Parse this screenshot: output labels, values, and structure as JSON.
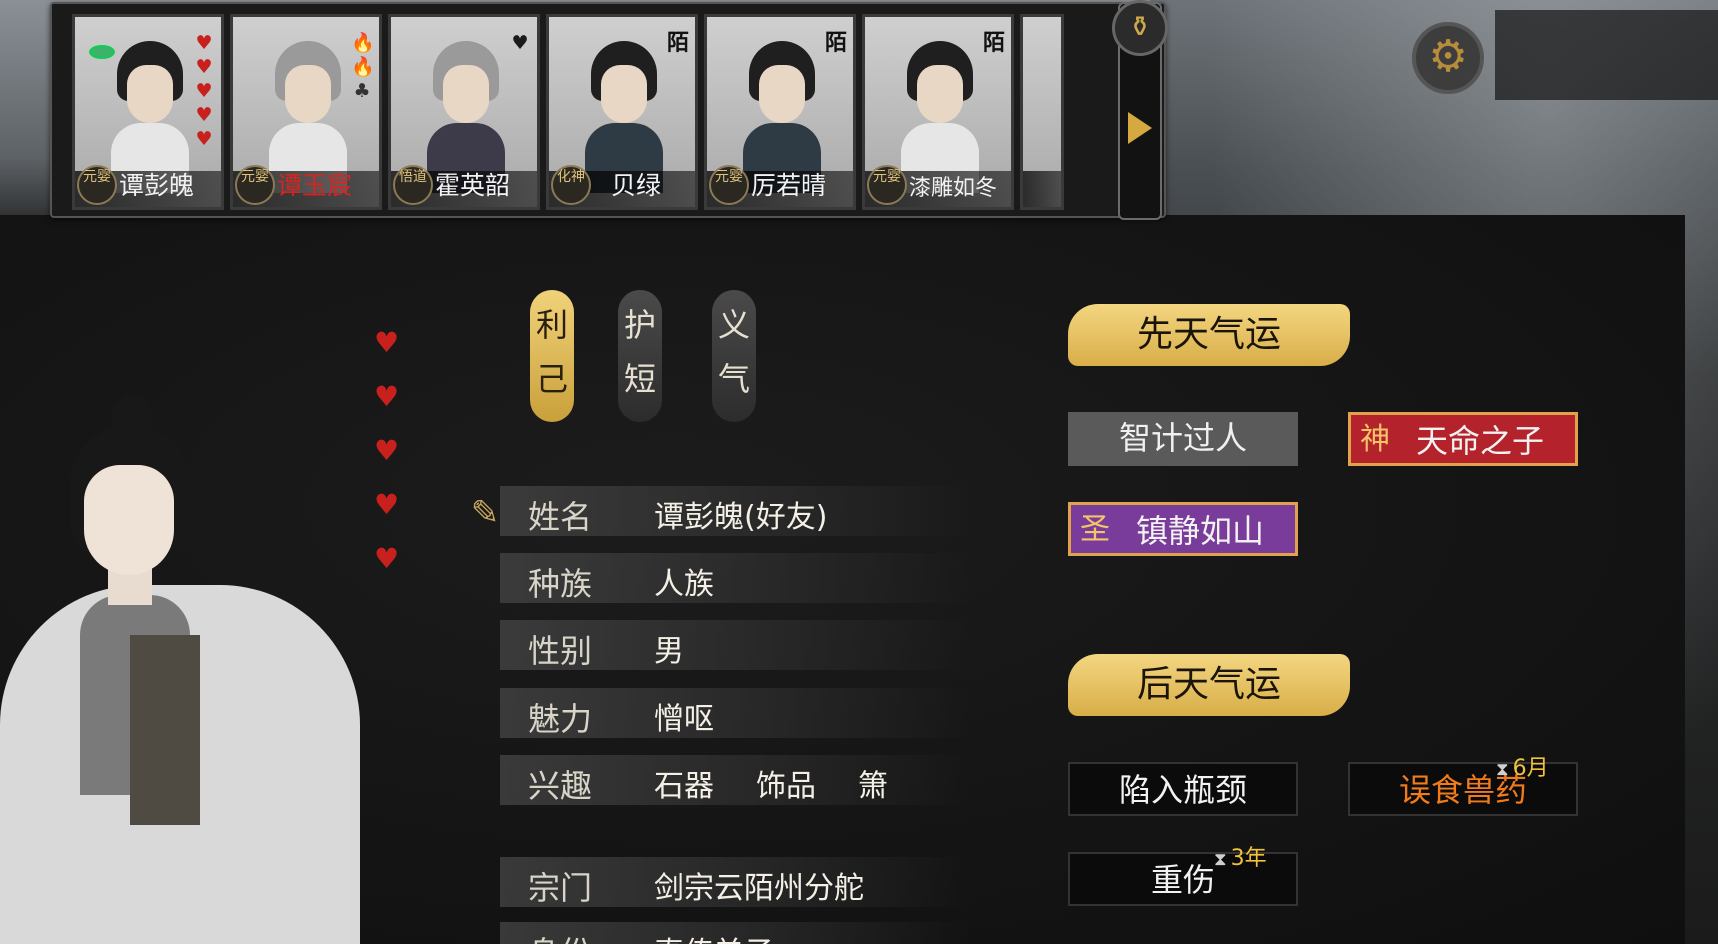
{
  "characters": [
    {
      "name": "谭彭魄",
      "realm": "元婴",
      "style": "red-hearts",
      "hearts": 5,
      "tag": "",
      "name_color": "white"
    },
    {
      "name": "谭玉宸",
      "realm": "元婴",
      "style": "flames",
      "hearts": 3,
      "tag": "",
      "name_color": "red"
    },
    {
      "name": "霍英韶",
      "realm": "悟道",
      "style": "one-heart",
      "hearts": 1,
      "tag": "",
      "name_color": "white"
    },
    {
      "name": "贝绿",
      "realm": "化神",
      "style": "tag",
      "hearts": 0,
      "tag": "陌",
      "name_color": "white"
    },
    {
      "name": "厉若晴",
      "realm": "元婴",
      "style": "tag",
      "hearts": 0,
      "tag": "陌",
      "name_color": "white"
    },
    {
      "name": "漆雕如冬",
      "realm": "元婴",
      "style": "tag",
      "hearts": 0,
      "tag": "陌",
      "name_color": "white"
    }
  ],
  "traits": [
    {
      "text1": "利",
      "text2": "己",
      "active": true
    },
    {
      "text1": "护",
      "text2": "短",
      "active": false
    },
    {
      "text1": "义",
      "text2": "气",
      "active": false
    }
  ],
  "info": {
    "name_label": "姓名",
    "name_value": "谭彭魄(好友)",
    "race_label": "种族",
    "race_value": "人族",
    "gender_label": "性别",
    "gender_value": "男",
    "charm_label": "魅力",
    "charm_value": "憎呕",
    "hobby_label": "兴趣",
    "hobbies": [
      "石器",
      "饰品",
      "箫"
    ],
    "sect_label": "宗门",
    "sect_value": "剑宗云陌州分舵",
    "identity_label": "身份",
    "identity_value": "真传弟子"
  },
  "fortune": {
    "innate_header": "先天气运",
    "innate": [
      {
        "text": "智计过人",
        "style": "grey",
        "seal": ""
      },
      {
        "text": "天命之子",
        "style": "red",
        "seal": "神"
      },
      {
        "text": "镇静如山",
        "style": "purple",
        "seal": "圣"
      }
    ],
    "acquired_header": "后天气运",
    "acquired": [
      {
        "text": "陷入瓶颈",
        "style": "black",
        "timer": ""
      },
      {
        "text": "误食兽药",
        "style": "black-orange",
        "timer": "6月"
      },
      {
        "text": "重伤",
        "style": "black",
        "timer": "3年"
      }
    ]
  },
  "side_hearts": 5,
  "icons": {
    "gourd": "gourd-icon",
    "next": "arrow-right-icon",
    "gear": "gear-icon",
    "edit": "edit-icon",
    "heart": "heart-icon",
    "hourglass": "hourglass-icon"
  },
  "colors": {
    "gold": "#d8ae48",
    "heart_red": "#c8211d",
    "divine_red": "#b4232b",
    "saint_purple": "#7a3c9a",
    "buff_orange": "#f07b1a"
  }
}
